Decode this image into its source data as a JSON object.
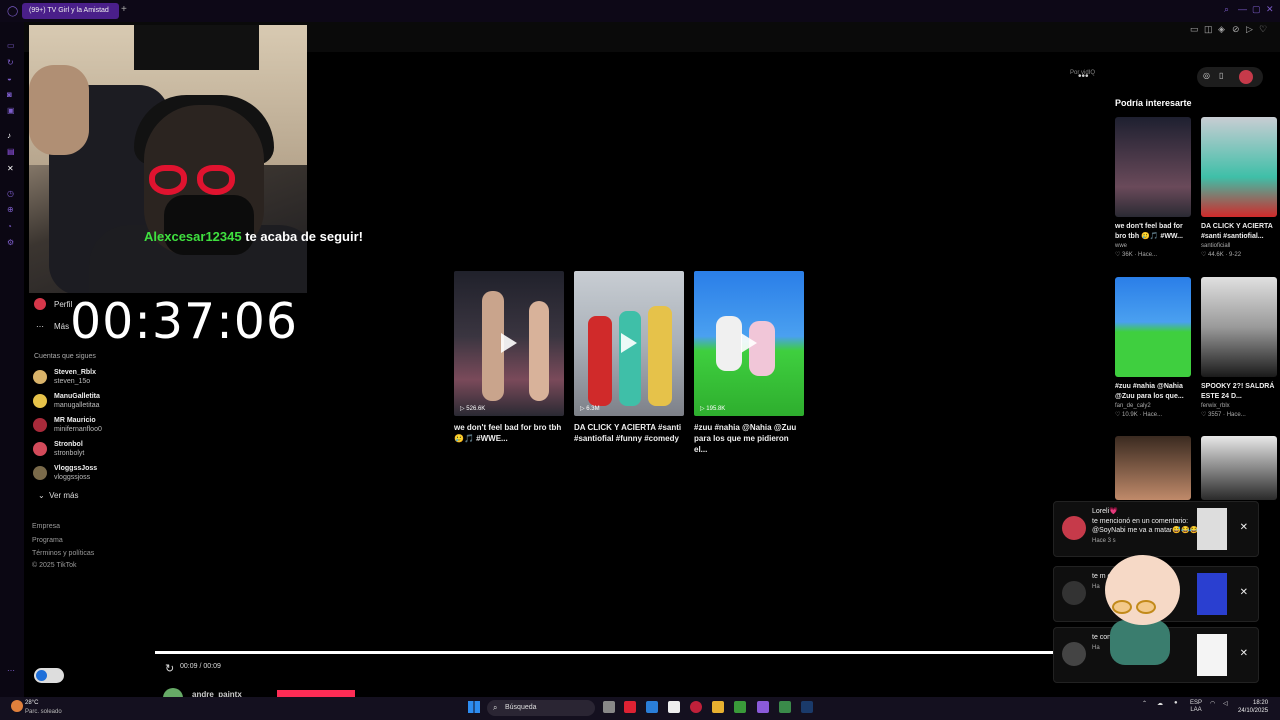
{
  "browser": {
    "tab_title": "(99+) TV Girl y la Amistad",
    "add_tab": "+",
    "window_controls": [
      "—",
      "▢",
      "✕"
    ]
  },
  "overlay": {
    "follow_user": "Alexcesar12345",
    "follow_text": " te acaba de seguir!",
    "timer": "00:37:06"
  },
  "sidebar": {
    "perfil": "Perfil",
    "mas": "Más",
    "following_title": "Cuentas que sigues",
    "accounts": [
      {
        "name": "Steven_Rblx",
        "handle": "steven_15o"
      },
      {
        "name": "ManuGalletita",
        "handle": "manugalletitaa"
      },
      {
        "name": "MR Mauricio",
        "handle": "minifernanfloo0"
      },
      {
        "name": "Stronbol",
        "handle": "stronbolyt"
      },
      {
        "name": "VloggssJoss",
        "handle": "vloggssjoss"
      }
    ],
    "ver_mas": "Ver más",
    "footer": [
      "Empresa",
      "Programa",
      "Términos y políticas",
      "© 2025 TikTok"
    ]
  },
  "main": {
    "por_vidiq": "Por vidIQ",
    "dots": "•••",
    "videos": [
      {
        "views": "526.6K",
        "caption": "we don't feel bad for bro tbh 🥲🎵 #WWE..."
      },
      {
        "views": "6.3M",
        "caption": "DA CLICK Y ACIERTA #santi #santiofial #funny #comedy"
      },
      {
        "views": "195.8K",
        "caption": "#zuu #nahia @Nahia @Zuu para los que me pidieron el..."
      }
    ]
  },
  "recommendations": {
    "title": "Podría interesarte",
    "items": [
      {
        "caption": "we don't feel bad for bro tbh 🥲🎵 #WW...",
        "account": "wwe",
        "stats": "36K · Hace..."
      },
      {
        "caption": "DA CLICK Y ACIERTA #santi #santiofial...",
        "account": "santioficiall",
        "stats": "44.6K · 9-22"
      },
      {
        "caption": "#zuu #nahia @Nahia @Zuu para los que...",
        "account": "fan_de_caly2",
        "stats": "10.9K · Hace..."
      },
      {
        "caption": "SPOOKY 2?! SALDRÁ ESTE 24 D...",
        "account": "ferwix_rblx",
        "stats": "3557 · Hace..."
      }
    ]
  },
  "notifications": [
    {
      "title": "Loreli💗",
      "body": "te mencionó en un comentario: @SoyNabi me va a matar😅😂😂",
      "time": "Hace 3 s"
    },
    {
      "title": "",
      "body": "te m co",
      "time": "Ha"
    },
    {
      "title": "",
      "body": "te con",
      "time": "Ha"
    }
  ],
  "player": {
    "progress": 1.0,
    "time": "00:09 / 00:09",
    "author": "andre_paintx"
  },
  "taskbar": {
    "temp": "28°C",
    "weather": "Parc. soleado",
    "search_placeholder": "Búsqueda",
    "lang1": "ESP",
    "lang2": "LAA",
    "time": "18:20",
    "date": "24/10/2025"
  },
  "colors": {
    "accent": "#7c5cc9",
    "follow_green": "#3fe03f",
    "tiktok_red": "#fe2c55"
  }
}
